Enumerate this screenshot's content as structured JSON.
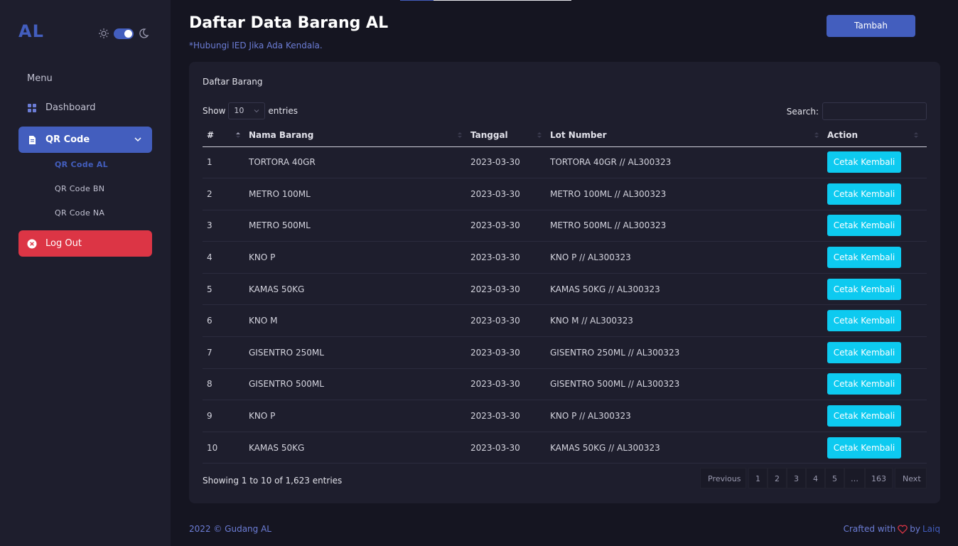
{
  "sidebar": {
    "logo": "AL",
    "menu_title": "Menu",
    "items": [
      {
        "label": "Dashboard"
      },
      {
        "label": "QR Code"
      },
      {
        "label": "Log Out"
      }
    ],
    "submenu": [
      {
        "label": "QR Code AL",
        "active": true
      },
      {
        "label": "QR Code BN",
        "active": false
      },
      {
        "label": "QR Code NA",
        "active": false
      }
    ],
    "theme_dark": true
  },
  "header": {
    "title": "Daftar Data Barang AL",
    "subtitle": "*Hubungi IED Jika Ada Kendala.",
    "add_button": "Tambah"
  },
  "card": {
    "title": "Daftar Barang",
    "show_label": "Show",
    "entries_label": "entries",
    "page_size": "10",
    "search_label": "Search:",
    "search_value": "",
    "columns": [
      "#",
      "Nama Barang",
      "Tanggal",
      "Lot Number",
      "Action"
    ],
    "rows": [
      {
        "no": "1",
        "name": "TORTORA 40GR",
        "date": "2023-03-30",
        "lot": "TORTORA 40GR // AL300323",
        "action": "Cetak Kembali"
      },
      {
        "no": "2",
        "name": "METRO 100ML",
        "date": "2023-03-30",
        "lot": "METRO 100ML // AL300323",
        "action": "Cetak Kembali"
      },
      {
        "no": "3",
        "name": "METRO 500ML",
        "date": "2023-03-30",
        "lot": "METRO 500ML // AL300323",
        "action": "Cetak Kembali"
      },
      {
        "no": "4",
        "name": "KNO P",
        "date": "2023-03-30",
        "lot": "KNO P // AL300323",
        "action": "Cetak Kembali"
      },
      {
        "no": "5",
        "name": "KAMAS 50KG",
        "date": "2023-03-30",
        "lot": "KAMAS 50KG // AL300323",
        "action": "Cetak Kembali"
      },
      {
        "no": "6",
        "name": "KNO M",
        "date": "2023-03-30",
        "lot": "KNO M // AL300323",
        "action": "Cetak Kembali"
      },
      {
        "no": "7",
        "name": "GISENTRO 250ML",
        "date": "2023-03-30",
        "lot": "GISENTRO 250ML // AL300323",
        "action": "Cetak Kembali"
      },
      {
        "no": "8",
        "name": "GISENTRO 500ML",
        "date": "2023-03-30",
        "lot": "GISENTRO 500ML // AL300323",
        "action": "Cetak Kembali"
      },
      {
        "no": "9",
        "name": "KNO P",
        "date": "2023-03-30",
        "lot": "KNO P // AL300323",
        "action": "Cetak Kembali"
      },
      {
        "no": "10",
        "name": "KAMAS 50KG",
        "date": "2023-03-30",
        "lot": "KAMAS 50KG // AL300323",
        "action": "Cetak Kembali"
      }
    ],
    "info": "Showing 1 to 10 of 1,623 entries",
    "pagination": {
      "prev": "Previous",
      "pages": [
        "1",
        "2",
        "3",
        "4",
        "5",
        "…",
        "163"
      ],
      "next": "Next"
    }
  },
  "footer": {
    "left": "2022 © Gudang AL",
    "right_prefix": "Crafted with",
    "right_by": "by",
    "author": "Laiq"
  },
  "colors": {
    "primary": "#435ebe",
    "danger": "#dc3545",
    "info": "#0dcaf0",
    "background": "#151521",
    "panel": "#1e1e2d"
  }
}
